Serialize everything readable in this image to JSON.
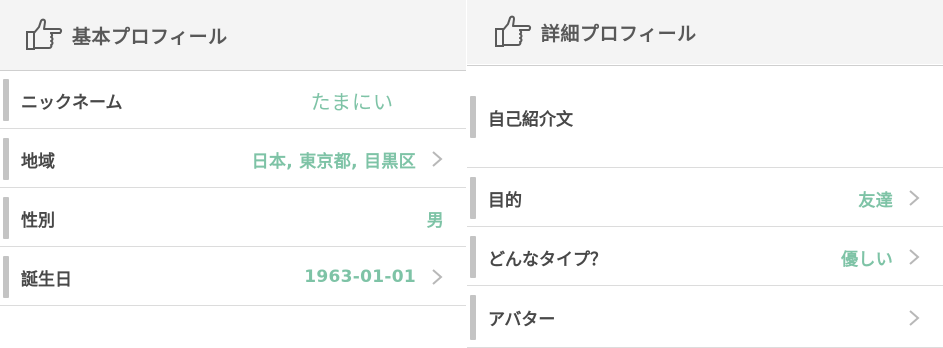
{
  "colors": {
    "accent_value": "#7ec3a6",
    "label": "#484848",
    "header_bg": "#f4f4f4",
    "row_bar": "#c4c4c4"
  },
  "basic_profile": {
    "icon": "thumbs-up-pointing-icon",
    "title": "基本プロフィール",
    "rows": [
      {
        "label": "ニックネーム",
        "value": "たまにい"
      },
      {
        "label": "地域",
        "value": "日本, 東京都, 目黒区"
      },
      {
        "label": "性別",
        "value": "男"
      },
      {
        "label": "誕生日",
        "value": "1963-01-01"
      }
    ]
  },
  "detail_profile": {
    "icon": "thumbs-up-pointing-icon",
    "title": "詳細プロフィール",
    "rows": [
      {
        "label": "自己紹介文",
        "value": ""
      },
      {
        "label": "目的",
        "value": "友達"
      },
      {
        "label": "どんなタイプ？",
        "value": "優しい"
      },
      {
        "label": "アバター",
        "value": ""
      }
    ]
  }
}
